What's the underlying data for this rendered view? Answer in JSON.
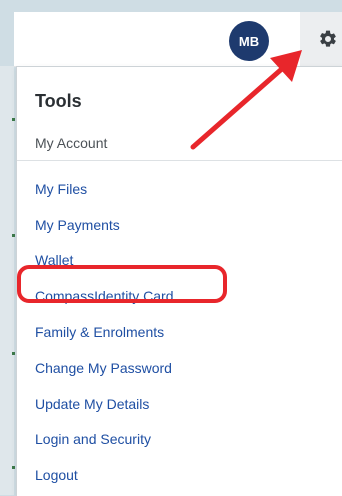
{
  "header": {
    "avatar_initials": "MB",
    "avatar_color": "#1e3a6e",
    "gear_icon": "gear-icon"
  },
  "menu": {
    "title": "Tools",
    "section_label": "My Account",
    "items": [
      {
        "label": "My Files"
      },
      {
        "label": "My Payments"
      },
      {
        "label": "Wallet"
      },
      {
        "label": "CompassIdentity Card"
      },
      {
        "label": "Family & Enrolments"
      },
      {
        "label": "Change My Password"
      },
      {
        "label": "Update My Details"
      },
      {
        "label": "Login and Security"
      },
      {
        "label": "Logout"
      }
    ],
    "link_color": "#1f4fa3"
  },
  "annotations": {
    "highlight_color": "#e8262b",
    "arrow_color": "#e8262b"
  }
}
